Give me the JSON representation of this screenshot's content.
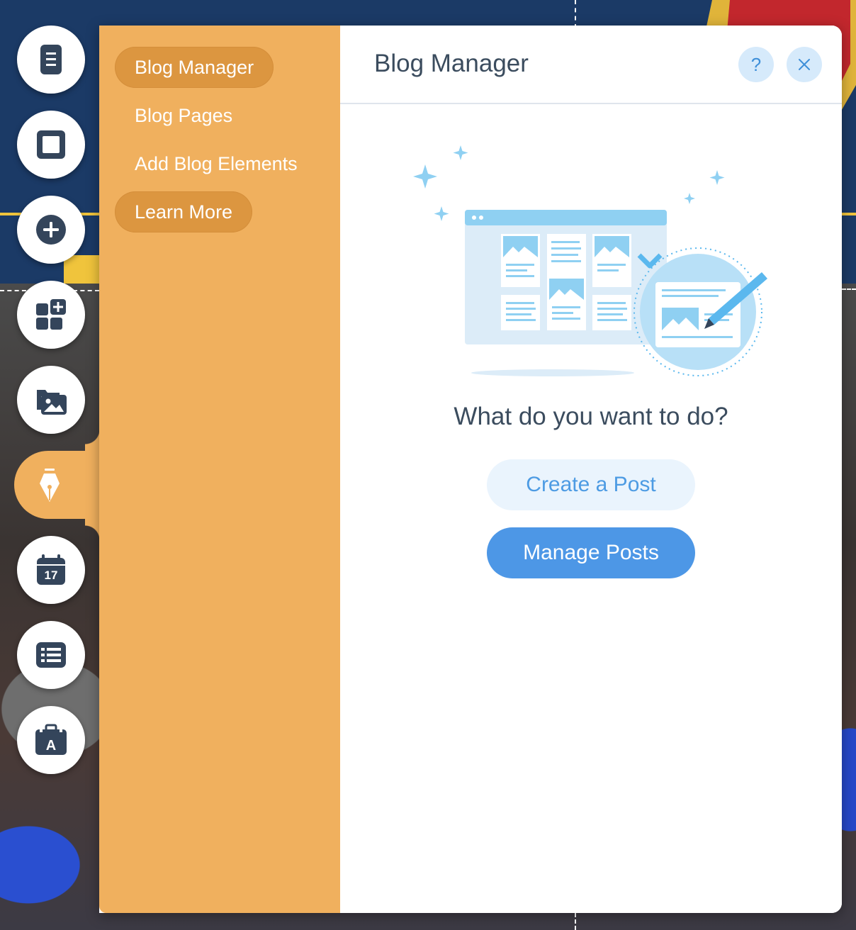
{
  "toolbar": {
    "buttons": [
      {
        "name": "pages-menu-button",
        "icon": "page-icon"
      },
      {
        "name": "background-button",
        "icon": "square-icon"
      },
      {
        "name": "add-button",
        "icon": "plus-icon"
      },
      {
        "name": "add-apps-button",
        "icon": "apps-icon"
      },
      {
        "name": "media-button",
        "icon": "media-icon"
      },
      {
        "name": "blog-button",
        "icon": "pen-nib-icon",
        "active": true
      },
      {
        "name": "bookings-button",
        "icon": "calendar-icon"
      },
      {
        "name": "list-button",
        "icon": "list-icon"
      },
      {
        "name": "business-button",
        "icon": "briefcase-icon"
      }
    ],
    "calendar_day": "17",
    "briefcase_letter": "A"
  },
  "menu": {
    "items": [
      {
        "label": "Blog Manager",
        "style": "pill"
      },
      {
        "label": "Blog Pages",
        "style": "plain"
      },
      {
        "label": "Add Blog Elements",
        "style": "plain"
      },
      {
        "label": "Learn More",
        "style": "pill"
      }
    ]
  },
  "panel": {
    "title": "Blog Manager",
    "help_label": "?",
    "question": "What do you want to do?",
    "create_label": "Create a Post",
    "manage_label": "Manage Posts"
  },
  "colors": {
    "accent_orange": "#f0b05e",
    "pill_orange": "#dc9640",
    "primary_blue": "#4d97e6",
    "light_blue": "#eaf4fd",
    "text_dark": "#3b4c5e",
    "icon_dark": "#34455b"
  }
}
